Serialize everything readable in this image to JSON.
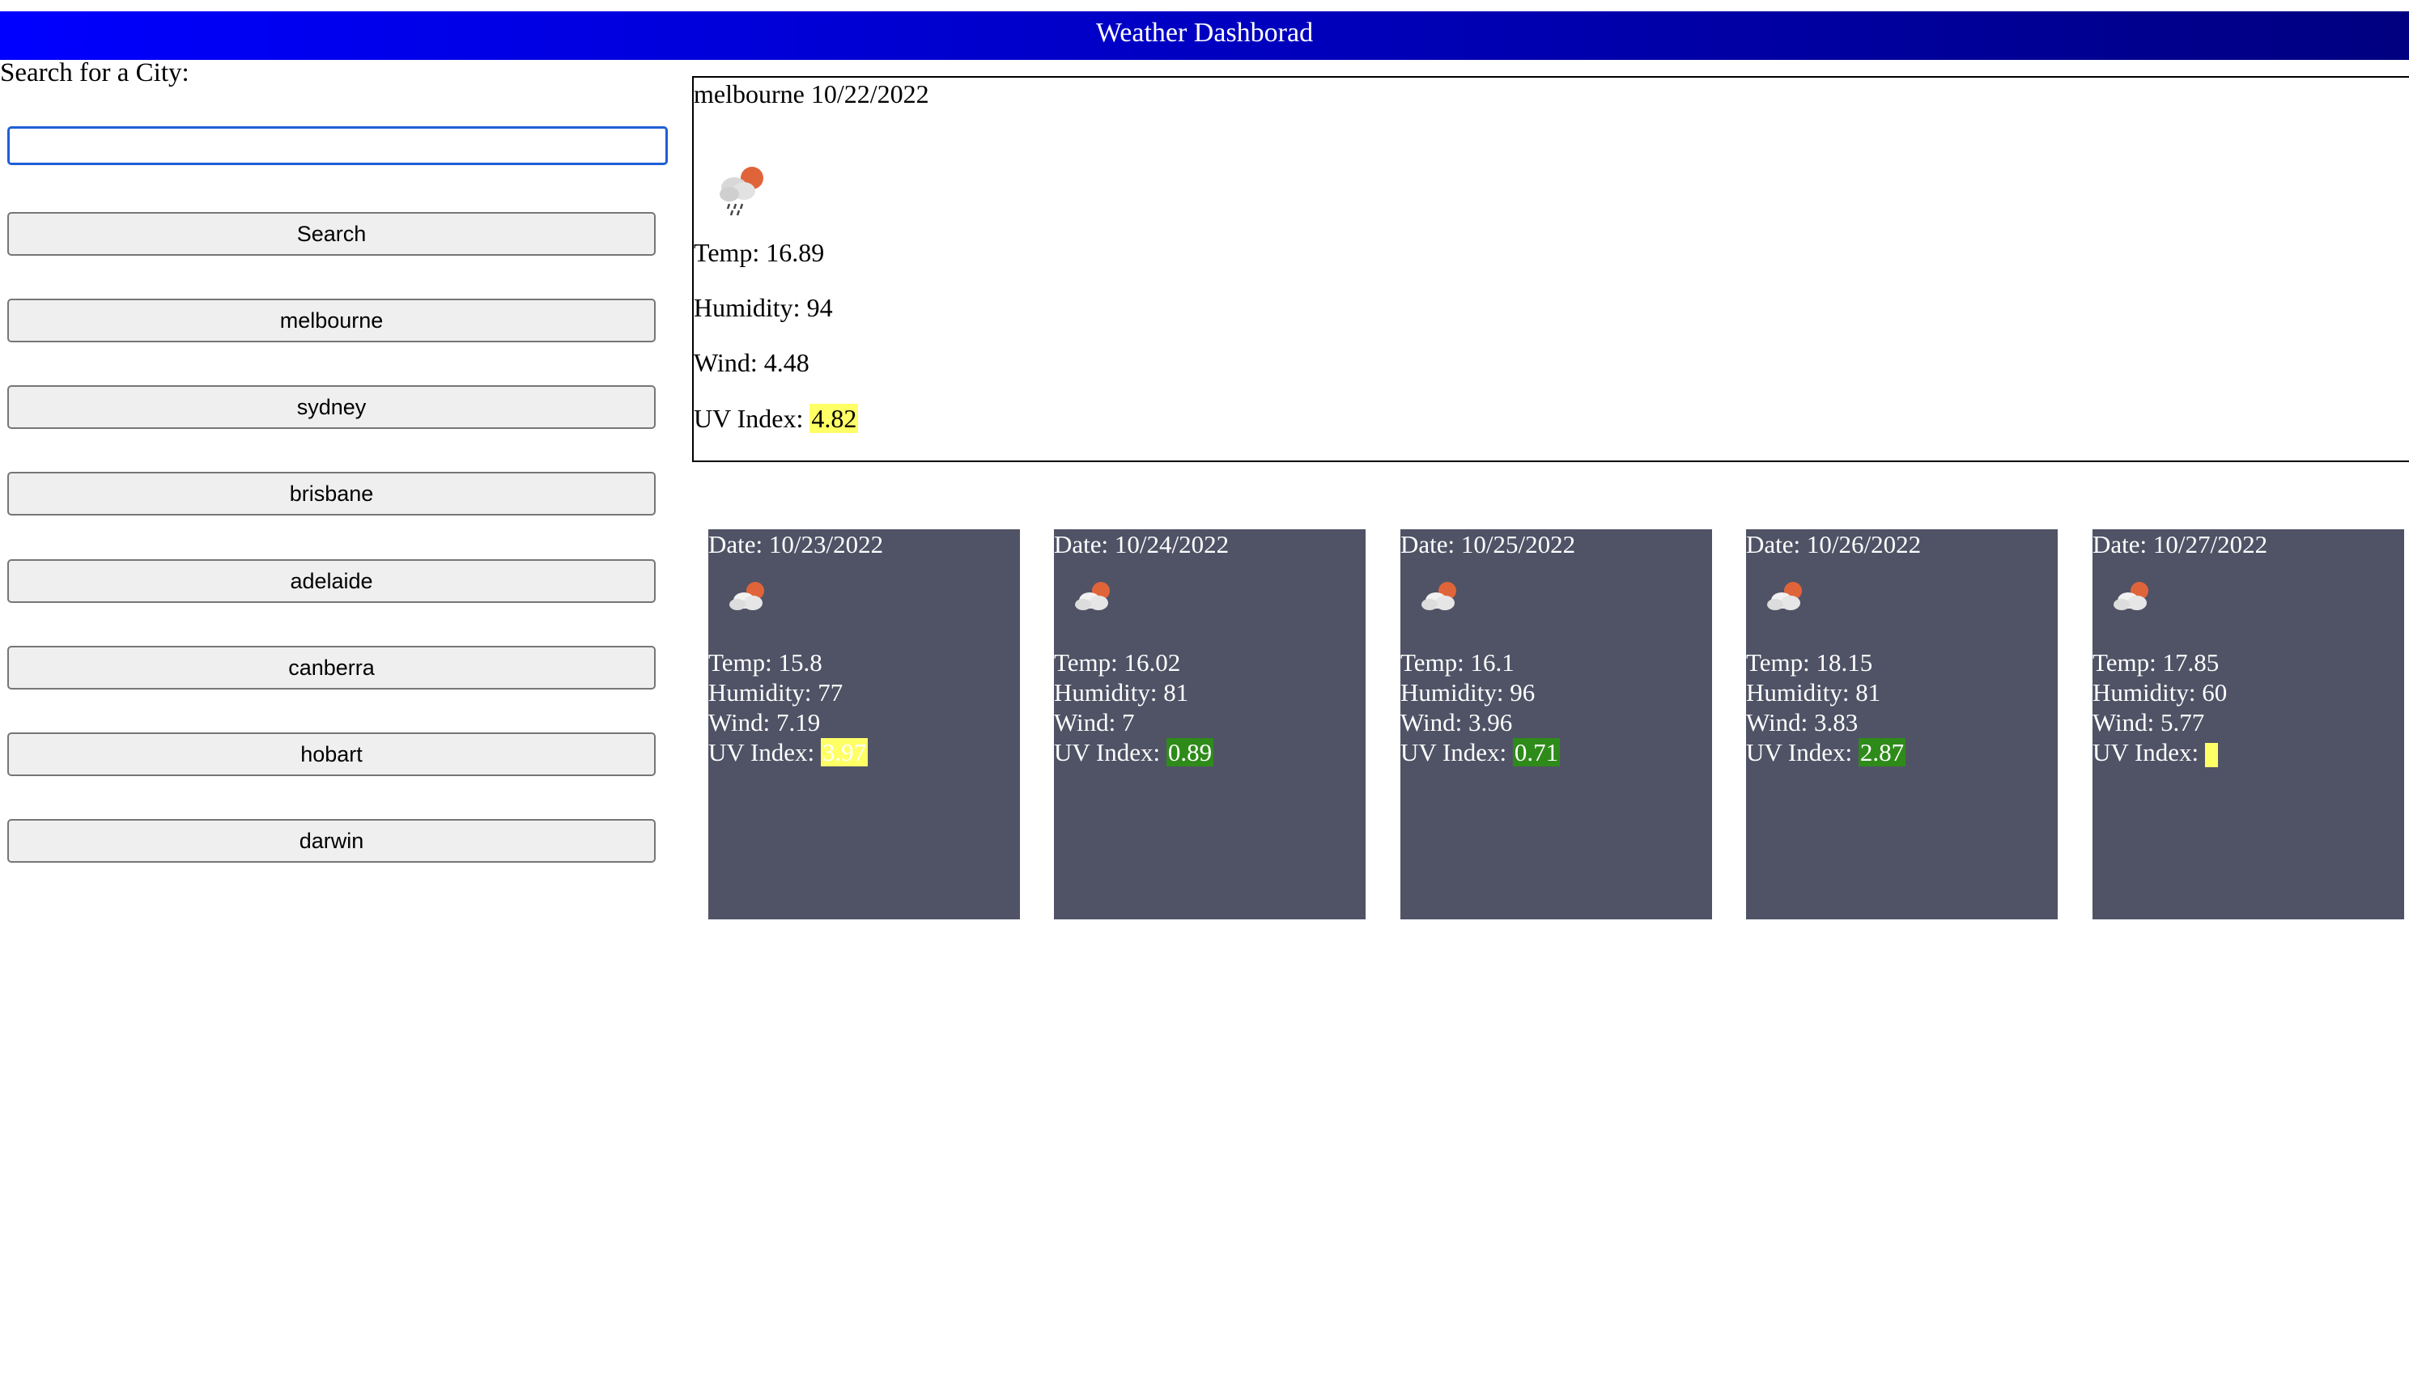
{
  "header": {
    "title": "Weather Dashborad"
  },
  "search": {
    "label": "Search for a City:",
    "value": "",
    "button_label": "Search"
  },
  "history": [
    "melbourne",
    "sydney",
    "brisbane",
    "adelaide",
    "canberra",
    "hobart",
    "darwin"
  ],
  "current": {
    "title": "melbourne 10/22/2022",
    "icon": "rain-cloud-sun-icon",
    "temp": "Temp: 16.89",
    "humidity": "Humidity: 94",
    "wind": "Wind: 4.48",
    "uv_label": "UV Index: ",
    "uv_value": "4.82",
    "uv_color": "#ffff66"
  },
  "forecast": [
    {
      "date": "Date: 10/23/2022",
      "icon": "cloud-sun-icon",
      "temp": "Temp: 15.8",
      "humidity": "Humidity: 77",
      "wind": "Wind: 7.19",
      "uv_label": "UV Index: ",
      "uv_value": "3.97",
      "uv_color": "#ffff66",
      "uv_text_color": "#ffffff"
    },
    {
      "date": "Date: 10/24/2022",
      "icon": "cloud-sun-icon",
      "temp": "Temp: 16.02",
      "humidity": "Humidity: 81",
      "wind": "Wind: 7",
      "uv_label": "UV Index: ",
      "uv_value": "0.89",
      "uv_color": "#2e8b1a",
      "uv_text_color": "#ffffff"
    },
    {
      "date": "Date: 10/25/2022",
      "icon": "cloud-sun-icon",
      "temp": "Temp: 16.1",
      "humidity": "Humidity: 96",
      "wind": "Wind: 3.96",
      "uv_label": "UV Index: ",
      "uv_value": "0.71",
      "uv_color": "#2e8b1a",
      "uv_text_color": "#ffffff"
    },
    {
      "date": "Date: 10/26/2022",
      "icon": "cloud-sun-icon",
      "temp": "Temp: 18.15",
      "humidity": "Humidity: 81",
      "wind": "Wind: 3.83",
      "uv_label": "UV Index: ",
      "uv_value": "2.87",
      "uv_color": "#2e8b1a",
      "uv_text_color": "#ffffff"
    },
    {
      "date": "Date: 10/27/2022",
      "icon": "cloud-sun-icon",
      "temp": "Temp: 17.85",
      "humidity": "Humidity: 60",
      "wind": "Wind: 5.77",
      "uv_label": "UV Index: ",
      "uv_value": "",
      "uv_color": "#ffff66",
      "uv_text_color": "#ffffff"
    }
  ]
}
